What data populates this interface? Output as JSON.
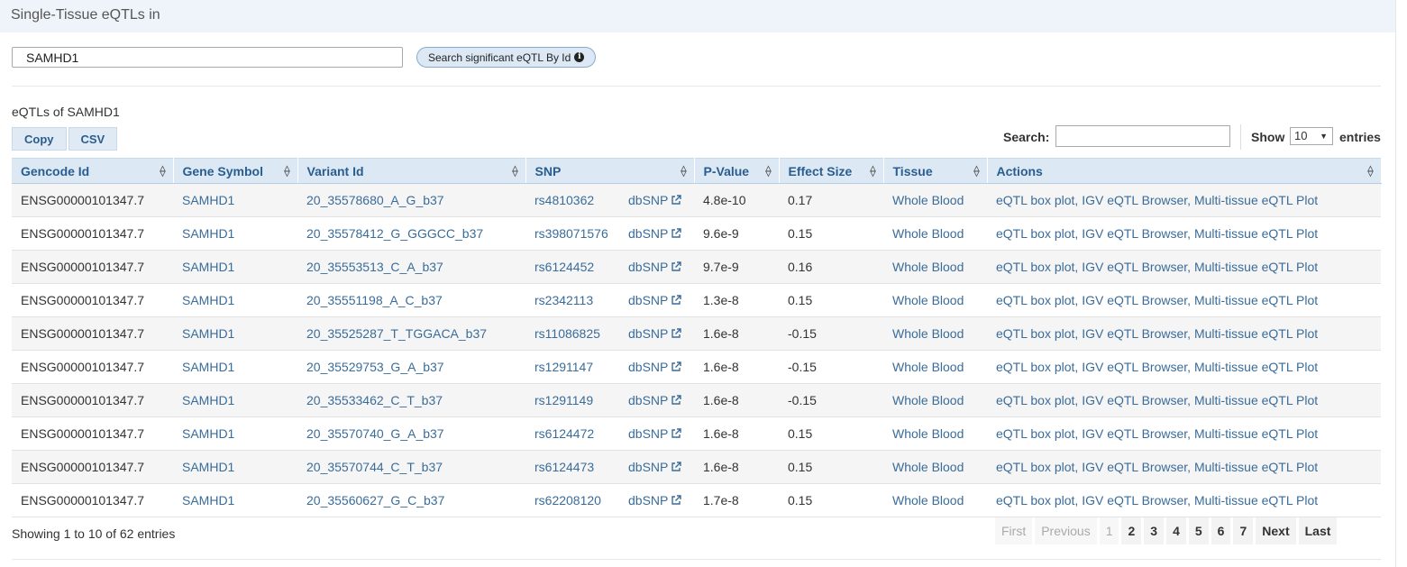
{
  "header": {
    "title": "Single-Tissue eQTLs in"
  },
  "search": {
    "value": "SAMHD1",
    "button_label": "Search significant eQTL By Id",
    "button_icon": "info-icon"
  },
  "caption": "eQTLs of SAMHD1",
  "toolbar": {
    "copy_label": "Copy",
    "csv_label": "CSV"
  },
  "filter": {
    "search_label": "Search:",
    "search_value": "",
    "show_label": "Show",
    "show_value": "10",
    "entries_label": "entries"
  },
  "table": {
    "columns": [
      "Gencode Id",
      "Gene Symbol",
      "Variant Id",
      "SNP",
      "P-Value",
      "Effect Size",
      "Tissue",
      "Actions"
    ],
    "dbsnp_label": "dbSNP",
    "rows": [
      {
        "gencode": "ENSG00000101347.7",
        "gene": "SAMHD1",
        "variant": "20_35578680_A_G_b37",
        "snp": "rs4810362",
        "pval": "4.8e-10",
        "effect": "0.17",
        "tissue": "Whole Blood",
        "actions": "eQTL box plot, IGV eQTL Browser, Multi-tissue eQTL Plot"
      },
      {
        "gencode": "ENSG00000101347.7",
        "gene": "SAMHD1",
        "variant": "20_35578412_G_GGGCC_b37",
        "snp": "rs398071576",
        "pval": "9.6e-9",
        "effect": "0.15",
        "tissue": "Whole Blood",
        "actions": "eQTL box plot, IGV eQTL Browser, Multi-tissue eQTL Plot"
      },
      {
        "gencode": "ENSG00000101347.7",
        "gene": "SAMHD1",
        "variant": "20_35553513_C_A_b37",
        "snp": "rs6124452",
        "pval": "9.7e-9",
        "effect": "0.16",
        "tissue": "Whole Blood",
        "actions": "eQTL box plot, IGV eQTL Browser, Multi-tissue eQTL Plot"
      },
      {
        "gencode": "ENSG00000101347.7",
        "gene": "SAMHD1",
        "variant": "20_35551198_A_C_b37",
        "snp": "rs2342113",
        "pval": "1.3e-8",
        "effect": "0.15",
        "tissue": "Whole Blood",
        "actions": "eQTL box plot, IGV eQTL Browser, Multi-tissue eQTL Plot"
      },
      {
        "gencode": "ENSG00000101347.7",
        "gene": "SAMHD1",
        "variant": "20_35525287_T_TGGACA_b37",
        "snp": "rs11086825",
        "pval": "1.6e-8",
        "effect": "-0.15",
        "tissue": "Whole Blood",
        "actions": "eQTL box plot, IGV eQTL Browser, Multi-tissue eQTL Plot"
      },
      {
        "gencode": "ENSG00000101347.7",
        "gene": "SAMHD1",
        "variant": "20_35529753_G_A_b37",
        "snp": "rs1291147",
        "pval": "1.6e-8",
        "effect": "-0.15",
        "tissue": "Whole Blood",
        "actions": "eQTL box plot, IGV eQTL Browser, Multi-tissue eQTL Plot"
      },
      {
        "gencode": "ENSG00000101347.7",
        "gene": "SAMHD1",
        "variant": "20_35533462_C_T_b37",
        "snp": "rs1291149",
        "pval": "1.6e-8",
        "effect": "-0.15",
        "tissue": "Whole Blood",
        "actions": "eQTL box plot, IGV eQTL Browser, Multi-tissue eQTL Plot"
      },
      {
        "gencode": "ENSG00000101347.7",
        "gene": "SAMHD1",
        "variant": "20_35570740_G_A_b37",
        "snp": "rs6124472",
        "pval": "1.6e-8",
        "effect": "0.15",
        "tissue": "Whole Blood",
        "actions": "eQTL box plot, IGV eQTL Browser, Multi-tissue eQTL Plot"
      },
      {
        "gencode": "ENSG00000101347.7",
        "gene": "SAMHD1",
        "variant": "20_35570744_C_T_b37",
        "snp": "rs6124473",
        "pval": "1.6e-8",
        "effect": "0.15",
        "tissue": "Whole Blood",
        "actions": "eQTL box plot, IGV eQTL Browser, Multi-tissue eQTL Plot"
      },
      {
        "gencode": "ENSG00000101347.7",
        "gene": "SAMHD1",
        "variant": "20_35560627_G_C_b37",
        "snp": "rs62208120",
        "pval": "1.7e-8",
        "effect": "0.15",
        "tissue": "Whole Blood",
        "actions": "eQTL box plot, IGV eQTL Browser, Multi-tissue eQTL Plot"
      }
    ]
  },
  "footer": {
    "info": "Showing 1 to 10 of 62 entries",
    "first": "First",
    "previous": "Previous",
    "pages": [
      "1",
      "2",
      "3",
      "4",
      "5",
      "6",
      "7"
    ],
    "current_page": "1",
    "next": "Next",
    "last": "Last"
  },
  "colors": {
    "header_bg": "#dce9f5",
    "link": "#3a6c9a",
    "stripe": "#f5f5f5"
  }
}
